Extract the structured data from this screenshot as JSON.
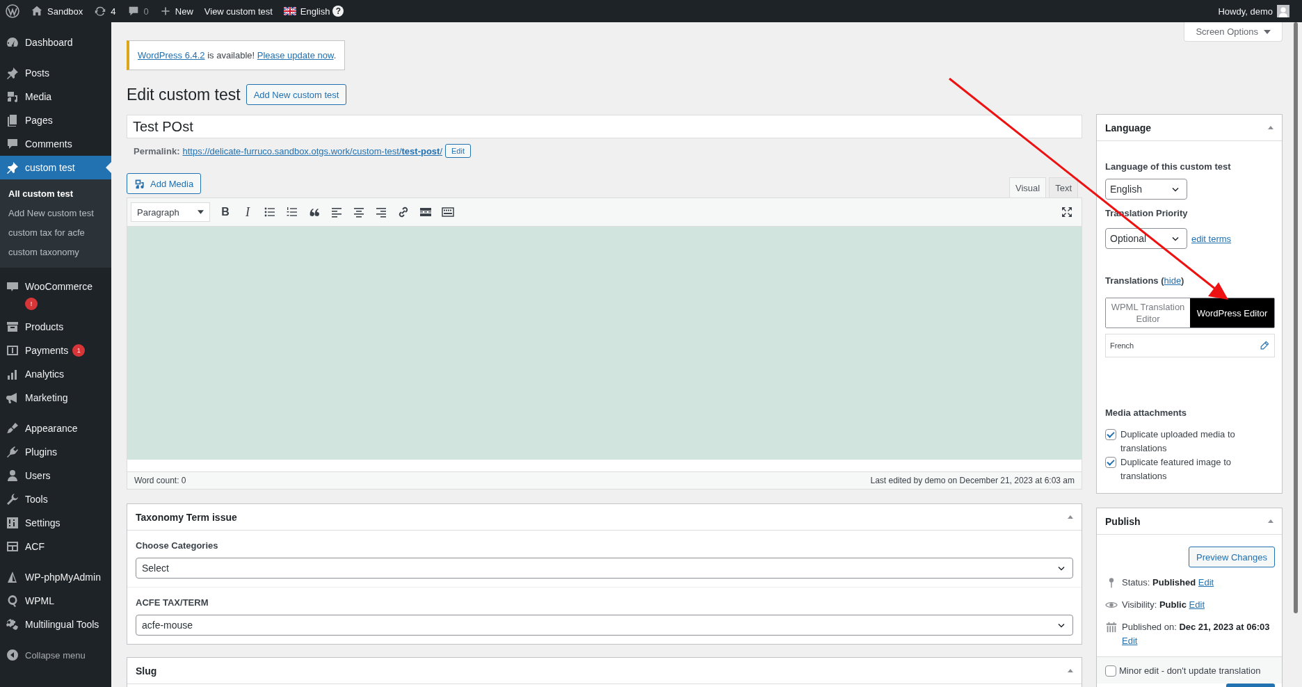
{
  "admin_bar": {
    "site": "Sandbox",
    "updates": "4",
    "comments": "0",
    "new": "New",
    "view": "View custom test",
    "language": "English",
    "help": "?",
    "greeting": "Howdy, demo"
  },
  "sidebar": {
    "groups": [
      [
        {
          "label": "Dashboard",
          "selected": false
        }
      ],
      [
        {
          "label": "Posts",
          "selected": false
        },
        {
          "label": "Media",
          "selected": false
        },
        {
          "label": "Pages",
          "selected": false
        },
        {
          "label": "Comments",
          "selected": false
        },
        {
          "label": "custom test",
          "selected": true,
          "children": [
            {
              "label": "All custom test",
              "selected": true
            },
            {
              "label": "Add New custom test",
              "selected": false
            },
            {
              "label": "custom tax for acfe",
              "selected": false
            },
            {
              "label": "custom taxonomy",
              "selected": false
            }
          ]
        }
      ],
      [
        {
          "label": "WooCommerce",
          "selected": false,
          "badge": "!",
          "color": "#d63638"
        },
        {
          "label": "Products",
          "selected": false
        },
        {
          "label": "Payments",
          "selected": false,
          "badge": "1",
          "color": "#d63638"
        },
        {
          "label": "Analytics",
          "selected": false
        },
        {
          "label": "Marketing",
          "selected": false
        }
      ],
      [
        {
          "label": "Appearance",
          "selected": false
        },
        {
          "label": "Plugins",
          "selected": false
        },
        {
          "label": "Users",
          "selected": false
        },
        {
          "label": "Tools",
          "selected": false
        },
        {
          "label": "Settings",
          "selected": false
        },
        {
          "label": "ACF",
          "selected": false
        }
      ],
      [
        {
          "label": "WP-phpMyAdmin",
          "selected": false
        },
        {
          "label": "WPML",
          "selected": false
        },
        {
          "label": "Multilingual Tools",
          "selected": false
        }
      ]
    ],
    "collapse": "Collapse menu"
  },
  "screen_options": "Screen Options",
  "notice": {
    "link": "WordPress 6.4.2",
    "text": " is available! ",
    "action": "Please update now",
    "end": "."
  },
  "heading": "Edit custom test",
  "add_new": "Add New custom test",
  "title_value": "Test POst",
  "permalink": {
    "label": "Permalink:",
    "url": "https://delicate-furruco.sandbox.otgs.work/custom-test/**test-post**/",
    "edit": "Edit"
  },
  "add_media": "Add Media",
  "editor_tabs": [
    {
      "label": "Visual",
      "selected": true
    },
    {
      "label": "Text",
      "selected": false
    }
  ],
  "toolbar": {
    "format": "Paragraph",
    "bold": "B",
    "italic": "I"
  },
  "word_count": "Word count: 0",
  "last_edited": "Last edited by demo on December 21, 2023 at 6:03 am",
  "taxonomy_panel": {
    "title": "Taxonomy Term issue",
    "fields": [
      {
        "label": "Choose Categories",
        "value": "Select"
      },
      {
        "label": "ACFE TAX/TERM",
        "value": "acfe-mouse"
      }
    ]
  },
  "slug_panel": {
    "title": "Slug"
  },
  "language_panel": {
    "title": "Language",
    "language_label": "Language of this custom test",
    "language": "English",
    "priority_label": "Translation Priority",
    "priority": "Optional",
    "edit_terms": "edit terms",
    "translations_label": "Translations (",
    "hide": "hide",
    "translations_end": ")",
    "editor_options": [
      {
        "label": "WPML Translation Editor",
        "selected": false
      },
      {
        "label": "WordPress Editor",
        "selected": true
      }
    ],
    "translations": [
      {
        "language": "French"
      }
    ],
    "media_title": "Media attachments",
    "media_options": [
      {
        "label": "Duplicate uploaded media to translations",
        "checked": true
      },
      {
        "label": "Duplicate featured image to translations",
        "checked": true
      }
    ]
  },
  "publish_panel": {
    "title": "Publish",
    "preview": "Preview Changes",
    "rows": [
      {
        "kind": "status",
        "label": "Status: ",
        "value": "Published",
        "link": "Edit"
      },
      {
        "kind": "visibility",
        "label": "Visibility: ",
        "value": "Public",
        "link": "Edit"
      },
      {
        "kind": "date",
        "label": "Published on: ",
        "value": "Dec 21, 2023 at 06:03",
        "link": "Edit"
      }
    ],
    "minor_edit": {
      "label": "Minor edit - don't update translation",
      "checked": false
    }
  }
}
